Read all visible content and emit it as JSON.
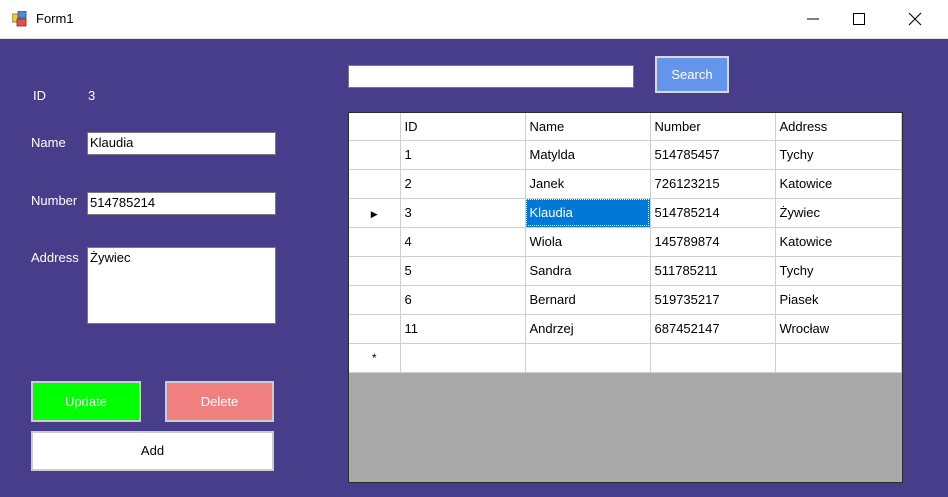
{
  "window": {
    "title": "Form1"
  },
  "form": {
    "id_label": "ID",
    "id_value": "3",
    "name_label": "Name",
    "name_value": "Klaudia",
    "number_label": "Number",
    "number_value": "514785214",
    "address_label": "Address",
    "address_value": "Żywiec",
    "update_label": "Update",
    "delete_label": "Delete",
    "add_label": "Add"
  },
  "search": {
    "value": "",
    "button_label": "Search"
  },
  "grid": {
    "columns": [
      "ID",
      "Name",
      "Number",
      "Address"
    ],
    "rows": [
      [
        "1",
        "Matylda",
        "514785457",
        "Tychy"
      ],
      [
        "2",
        "Janek",
        "726123215",
        "Katowice"
      ],
      [
        "3",
        "Klaudia",
        "514785214",
        "Żywiec"
      ],
      [
        "4",
        "Wiola",
        "145789874",
        "Katowice"
      ],
      [
        "5",
        "Sandra",
        "511785211",
        "Tychy"
      ],
      [
        "6",
        "Bernard",
        "519735217",
        "Piasek"
      ],
      [
        "11",
        "Andrzej",
        "687452147",
        "Wrocław"
      ]
    ],
    "current_row_indicator": "▶",
    "new_row_indicator": "*"
  },
  "colors": {
    "background": "#483d8b",
    "update": "#00ff00",
    "delete": "#f08080",
    "search": "#6495ed",
    "selection": "#0078d7"
  }
}
